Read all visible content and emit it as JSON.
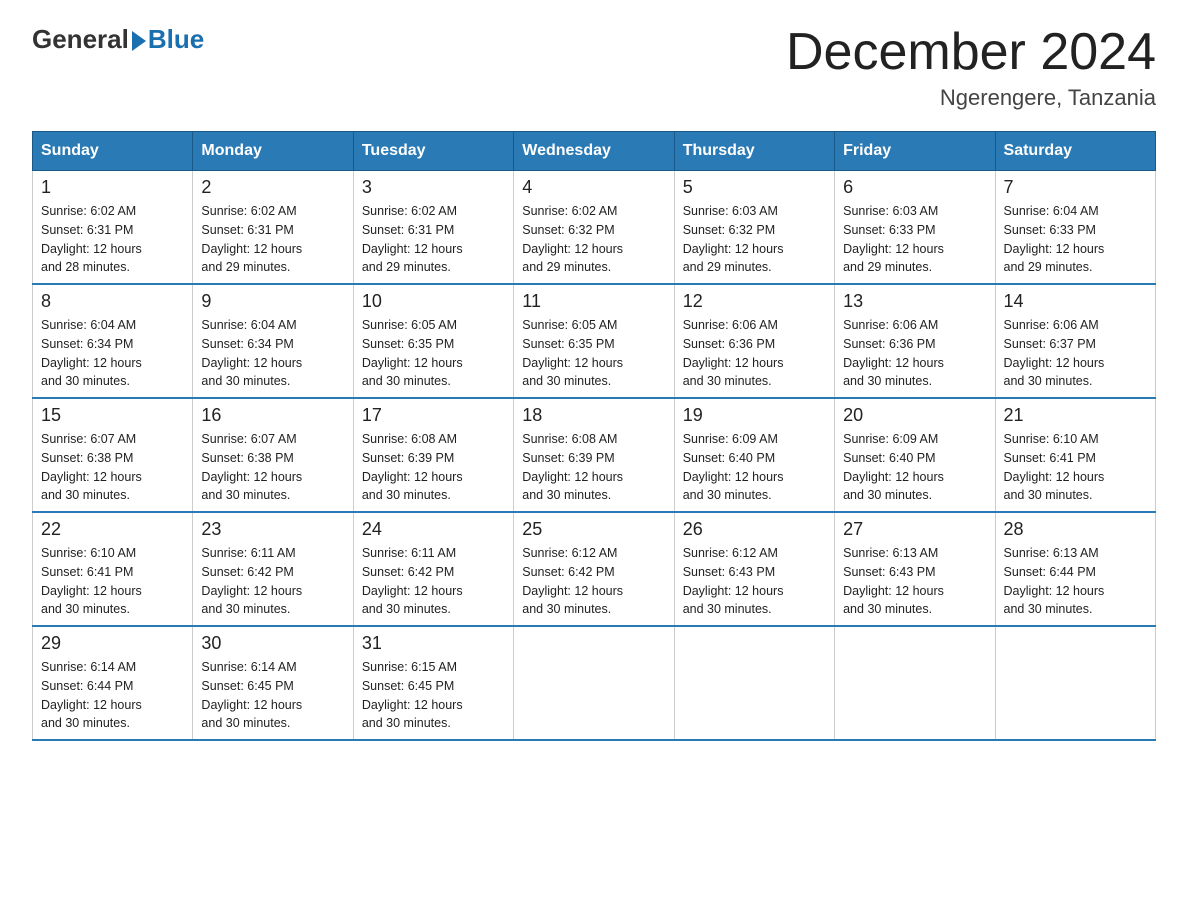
{
  "logo": {
    "general": "General",
    "blue": "Blue",
    "subtitle": ""
  },
  "title": "December 2024",
  "subtitle": "Ngerengere, Tanzania",
  "days_header": [
    "Sunday",
    "Monday",
    "Tuesday",
    "Wednesday",
    "Thursday",
    "Friday",
    "Saturday"
  ],
  "weeks": [
    [
      {
        "day": "1",
        "sunrise": "6:02 AM",
        "sunset": "6:31 PM",
        "daylight": "12 hours and 28 minutes."
      },
      {
        "day": "2",
        "sunrise": "6:02 AM",
        "sunset": "6:31 PM",
        "daylight": "12 hours and 29 minutes."
      },
      {
        "day": "3",
        "sunrise": "6:02 AM",
        "sunset": "6:31 PM",
        "daylight": "12 hours and 29 minutes."
      },
      {
        "day": "4",
        "sunrise": "6:02 AM",
        "sunset": "6:32 PM",
        "daylight": "12 hours and 29 minutes."
      },
      {
        "day": "5",
        "sunrise": "6:03 AM",
        "sunset": "6:32 PM",
        "daylight": "12 hours and 29 minutes."
      },
      {
        "day": "6",
        "sunrise": "6:03 AM",
        "sunset": "6:33 PM",
        "daylight": "12 hours and 29 minutes."
      },
      {
        "day": "7",
        "sunrise": "6:04 AM",
        "sunset": "6:33 PM",
        "daylight": "12 hours and 29 minutes."
      }
    ],
    [
      {
        "day": "8",
        "sunrise": "6:04 AM",
        "sunset": "6:34 PM",
        "daylight": "12 hours and 30 minutes."
      },
      {
        "day": "9",
        "sunrise": "6:04 AM",
        "sunset": "6:34 PM",
        "daylight": "12 hours and 30 minutes."
      },
      {
        "day": "10",
        "sunrise": "6:05 AM",
        "sunset": "6:35 PM",
        "daylight": "12 hours and 30 minutes."
      },
      {
        "day": "11",
        "sunrise": "6:05 AM",
        "sunset": "6:35 PM",
        "daylight": "12 hours and 30 minutes."
      },
      {
        "day": "12",
        "sunrise": "6:06 AM",
        "sunset": "6:36 PM",
        "daylight": "12 hours and 30 minutes."
      },
      {
        "day": "13",
        "sunrise": "6:06 AM",
        "sunset": "6:36 PM",
        "daylight": "12 hours and 30 minutes."
      },
      {
        "day": "14",
        "sunrise": "6:06 AM",
        "sunset": "6:37 PM",
        "daylight": "12 hours and 30 minutes."
      }
    ],
    [
      {
        "day": "15",
        "sunrise": "6:07 AM",
        "sunset": "6:38 PM",
        "daylight": "12 hours and 30 minutes."
      },
      {
        "day": "16",
        "sunrise": "6:07 AM",
        "sunset": "6:38 PM",
        "daylight": "12 hours and 30 minutes."
      },
      {
        "day": "17",
        "sunrise": "6:08 AM",
        "sunset": "6:39 PM",
        "daylight": "12 hours and 30 minutes."
      },
      {
        "day": "18",
        "sunrise": "6:08 AM",
        "sunset": "6:39 PM",
        "daylight": "12 hours and 30 minutes."
      },
      {
        "day": "19",
        "sunrise": "6:09 AM",
        "sunset": "6:40 PM",
        "daylight": "12 hours and 30 minutes."
      },
      {
        "day": "20",
        "sunrise": "6:09 AM",
        "sunset": "6:40 PM",
        "daylight": "12 hours and 30 minutes."
      },
      {
        "day": "21",
        "sunrise": "6:10 AM",
        "sunset": "6:41 PM",
        "daylight": "12 hours and 30 minutes."
      }
    ],
    [
      {
        "day": "22",
        "sunrise": "6:10 AM",
        "sunset": "6:41 PM",
        "daylight": "12 hours and 30 minutes."
      },
      {
        "day": "23",
        "sunrise": "6:11 AM",
        "sunset": "6:42 PM",
        "daylight": "12 hours and 30 minutes."
      },
      {
        "day": "24",
        "sunrise": "6:11 AM",
        "sunset": "6:42 PM",
        "daylight": "12 hours and 30 minutes."
      },
      {
        "day": "25",
        "sunrise": "6:12 AM",
        "sunset": "6:42 PM",
        "daylight": "12 hours and 30 minutes."
      },
      {
        "day": "26",
        "sunrise": "6:12 AM",
        "sunset": "6:43 PM",
        "daylight": "12 hours and 30 minutes."
      },
      {
        "day": "27",
        "sunrise": "6:13 AM",
        "sunset": "6:43 PM",
        "daylight": "12 hours and 30 minutes."
      },
      {
        "day": "28",
        "sunrise": "6:13 AM",
        "sunset": "6:44 PM",
        "daylight": "12 hours and 30 minutes."
      }
    ],
    [
      {
        "day": "29",
        "sunrise": "6:14 AM",
        "sunset": "6:44 PM",
        "daylight": "12 hours and 30 minutes."
      },
      {
        "day": "30",
        "sunrise": "6:14 AM",
        "sunset": "6:45 PM",
        "daylight": "12 hours and 30 minutes."
      },
      {
        "day": "31",
        "sunrise": "6:15 AM",
        "sunset": "6:45 PM",
        "daylight": "12 hours and 30 minutes."
      },
      null,
      null,
      null,
      null
    ]
  ],
  "labels": {
    "sunrise": "Sunrise:",
    "sunset": "Sunset:",
    "daylight": "Daylight:"
  }
}
